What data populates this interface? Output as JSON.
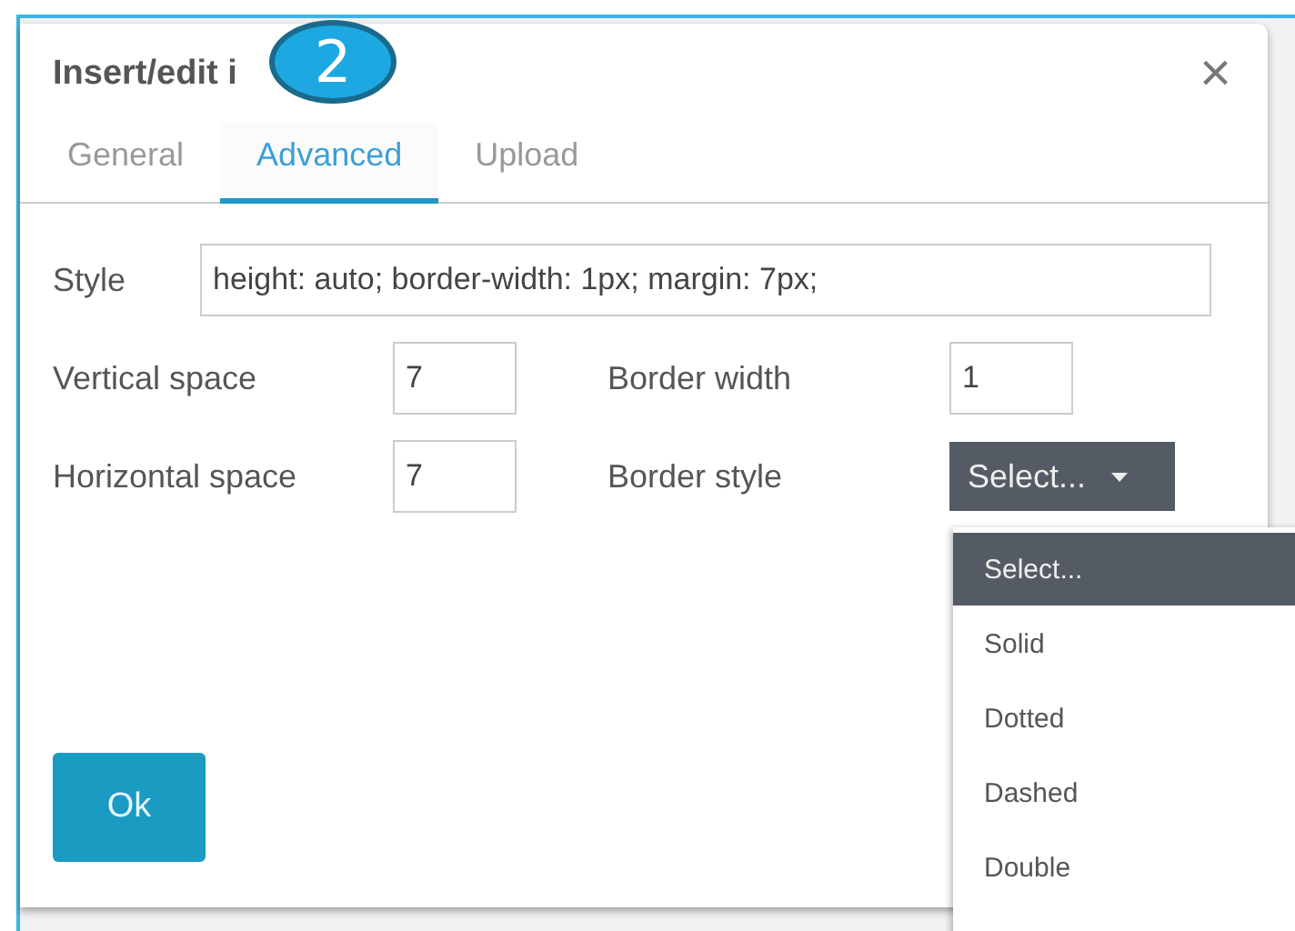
{
  "dialog": {
    "title": "Insert/edit i",
    "close": "×",
    "tabs": [
      {
        "label": "General",
        "selected": false
      },
      {
        "label": "Advanced",
        "selected": true
      },
      {
        "label": "Upload",
        "selected": false
      }
    ],
    "style": {
      "label": "Style",
      "value": "height: auto; border-width: 1px; margin: 7px;"
    },
    "rows": [
      {
        "label": "Vertical space",
        "value": "7",
        "label_2": "Border width",
        "value_2": "1",
        "kind": "input"
      },
      {
        "label": "Horizontal space",
        "value": "7",
        "label_2": "Border style",
        "value_2": "Select...",
        "kind": "select"
      }
    ],
    "ok_button": "Ok"
  },
  "dropdown": {
    "options": [
      {
        "label": "Select...",
        "selected": true
      },
      {
        "label": "Solid",
        "selected": false
      },
      {
        "label": "Dotted",
        "selected": false
      },
      {
        "label": "Dashed",
        "selected": false
      },
      {
        "label": "Double",
        "selected": false
      }
    ]
  },
  "step_badge": "2"
}
